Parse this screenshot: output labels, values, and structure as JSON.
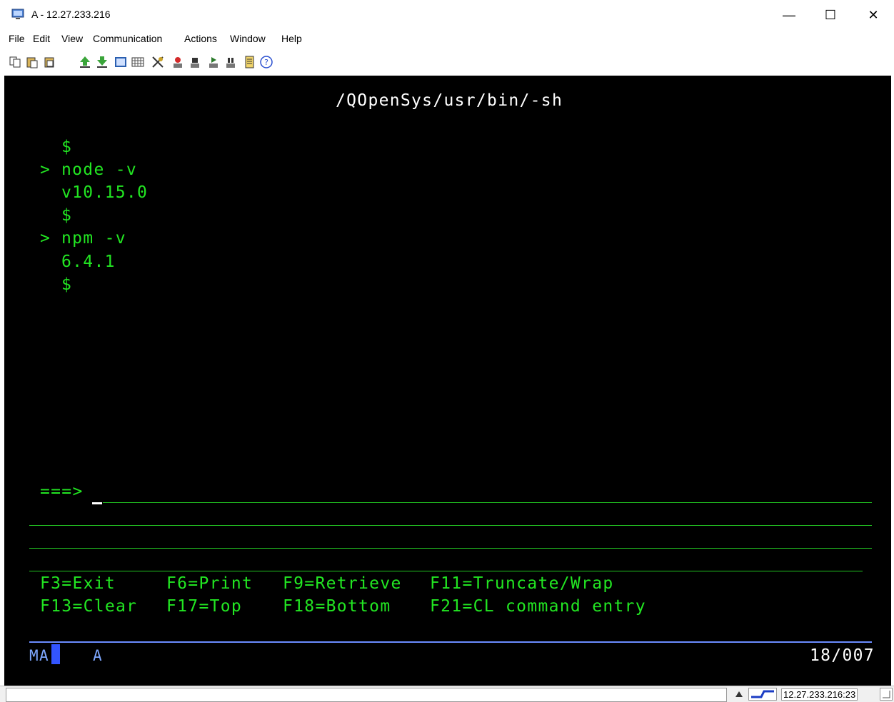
{
  "window": {
    "title": "A - 12.27.233.216",
    "minimize": "—",
    "maximize": "☐",
    "close": "✕"
  },
  "menu": [
    "File",
    "Edit",
    "View",
    "Communication",
    "Actions",
    "Window",
    "Help"
  ],
  "toolbar_icons": [
    "copy-icon",
    "paste-icon",
    "paste-next-icon",
    "send-file-icon",
    "receive-file-icon",
    "display-image-icon",
    "keypad-icon",
    "customize-icon",
    "record-macro-icon",
    "stop-macro-icon",
    "play-macro-icon",
    "pause-macro-icon",
    "notes-icon",
    "help-icon"
  ],
  "screen": {
    "header": "/QOpenSys/usr/bin/-sh",
    "lines": [
      {
        "prefix": "",
        "text": "$"
      },
      {
        "prefix": ">",
        "text": "node -v"
      },
      {
        "prefix": "",
        "text": "v10.15.0"
      },
      {
        "prefix": "",
        "text": "$"
      },
      {
        "prefix": ">",
        "text": "npm -v"
      },
      {
        "prefix": "",
        "text": "6.4.1"
      },
      {
        "prefix": "",
        "text": "$"
      }
    ],
    "prompt": "===>",
    "function_keys": [
      [
        "F3=Exit",
        "F6=Print",
        "F9=Retrieve",
        "F11=Truncate/Wrap"
      ],
      [
        "F13=Clear",
        "F17=Top",
        "F18=Bottom",
        "F21=CL command entry"
      ]
    ],
    "oia_left": "MA",
    "oia_mode": "A",
    "cursor_position": "18/007"
  },
  "status": {
    "address": "12.27.233.216:23"
  },
  "colors": {
    "terminal_bg": "#000000",
    "terminal_text": "#22e622",
    "header_text": "#ffffff",
    "oia_text": "#7ea7ff"
  }
}
